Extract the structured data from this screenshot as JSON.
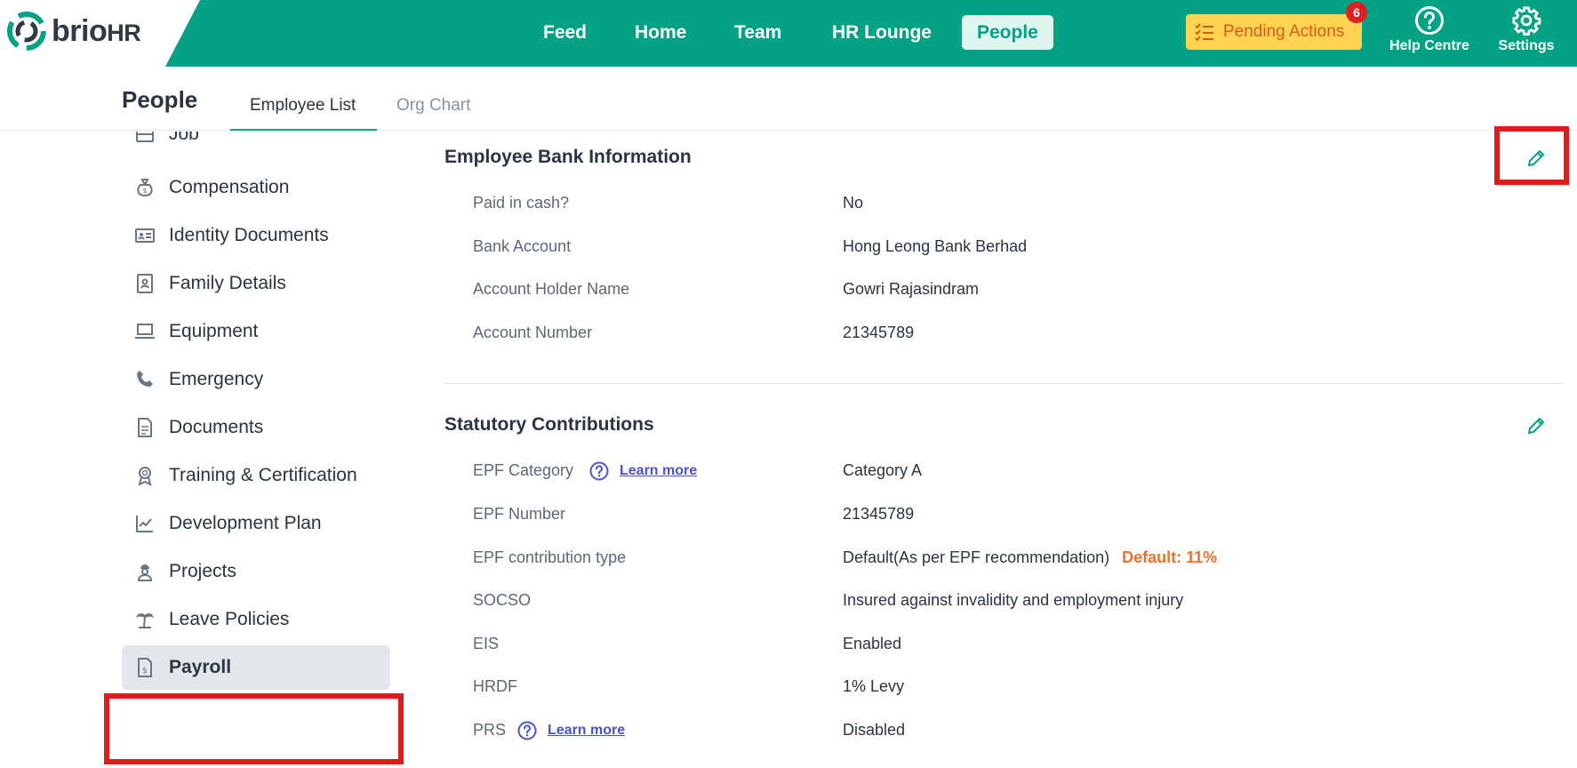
{
  "app": {
    "logo_text": "brio",
    "logo_suffix": "HR"
  },
  "nav": {
    "items": [
      {
        "label": "Feed"
      },
      {
        "label": "Home"
      },
      {
        "label": "Team"
      },
      {
        "label": "HR Lounge"
      },
      {
        "label": "People",
        "active": true
      }
    ]
  },
  "pending": {
    "label": "Pending Actions",
    "count": "6"
  },
  "top_icons": {
    "help": "Help Centre",
    "settings": "Settings"
  },
  "page": {
    "title": "People",
    "tabs": [
      {
        "label": "Employee List",
        "active": true
      },
      {
        "label": "Org Chart"
      }
    ]
  },
  "sidebar": {
    "items": [
      {
        "label": "Job",
        "icon": "briefcase-icon"
      },
      {
        "label": "Compensation",
        "icon": "money-bag-icon"
      },
      {
        "label": "Identity Documents",
        "icon": "id-card-icon"
      },
      {
        "label": "Family Details",
        "icon": "contact-book-icon"
      },
      {
        "label": "Equipment",
        "icon": "laptop-icon"
      },
      {
        "label": "Emergency",
        "icon": "phone-icon"
      },
      {
        "label": "Documents",
        "icon": "document-icon"
      },
      {
        "label": "Training & Certification",
        "icon": "award-icon"
      },
      {
        "label": "Development Plan",
        "icon": "trend-chart-icon"
      },
      {
        "label": "Projects",
        "icon": "worker-icon"
      },
      {
        "label": "Leave Policies",
        "icon": "palm-tree-icon"
      },
      {
        "label": "Payroll",
        "icon": "payroll-icon",
        "active": true
      }
    ]
  },
  "bank": {
    "title": "Employee Bank Information",
    "rows": [
      {
        "label": "Paid in cash?",
        "value": "No"
      },
      {
        "label": "Bank Account",
        "value": "Hong Leong Bank Berhad"
      },
      {
        "label": "Account Holder Name",
        "value": "Gowri Rajasindram"
      },
      {
        "label": "Account Number",
        "value": "21345789"
      }
    ]
  },
  "statutory": {
    "title": "Statutory Contributions",
    "learn_more": "Learn more",
    "rows": [
      {
        "label": "EPF Category",
        "value": "Category A"
      },
      {
        "label": "EPF Number",
        "value": "21345789"
      },
      {
        "label": "EPF contribution type",
        "value": "Default(As per EPF recommendation)",
        "tag": "Default: 11%"
      },
      {
        "label": "SOCSO",
        "value": "Insured against invalidity and employment injury"
      },
      {
        "label": "EIS",
        "value": "Enabled"
      },
      {
        "label": "HRDF",
        "value": "1% Levy"
      },
      {
        "label": "PRS",
        "value": "Disabled"
      }
    ]
  },
  "colors": {
    "brand": "#03a284",
    "highlight": "#e01b1b",
    "pending_bg": "#ffd451",
    "tag": "#f0702a"
  }
}
